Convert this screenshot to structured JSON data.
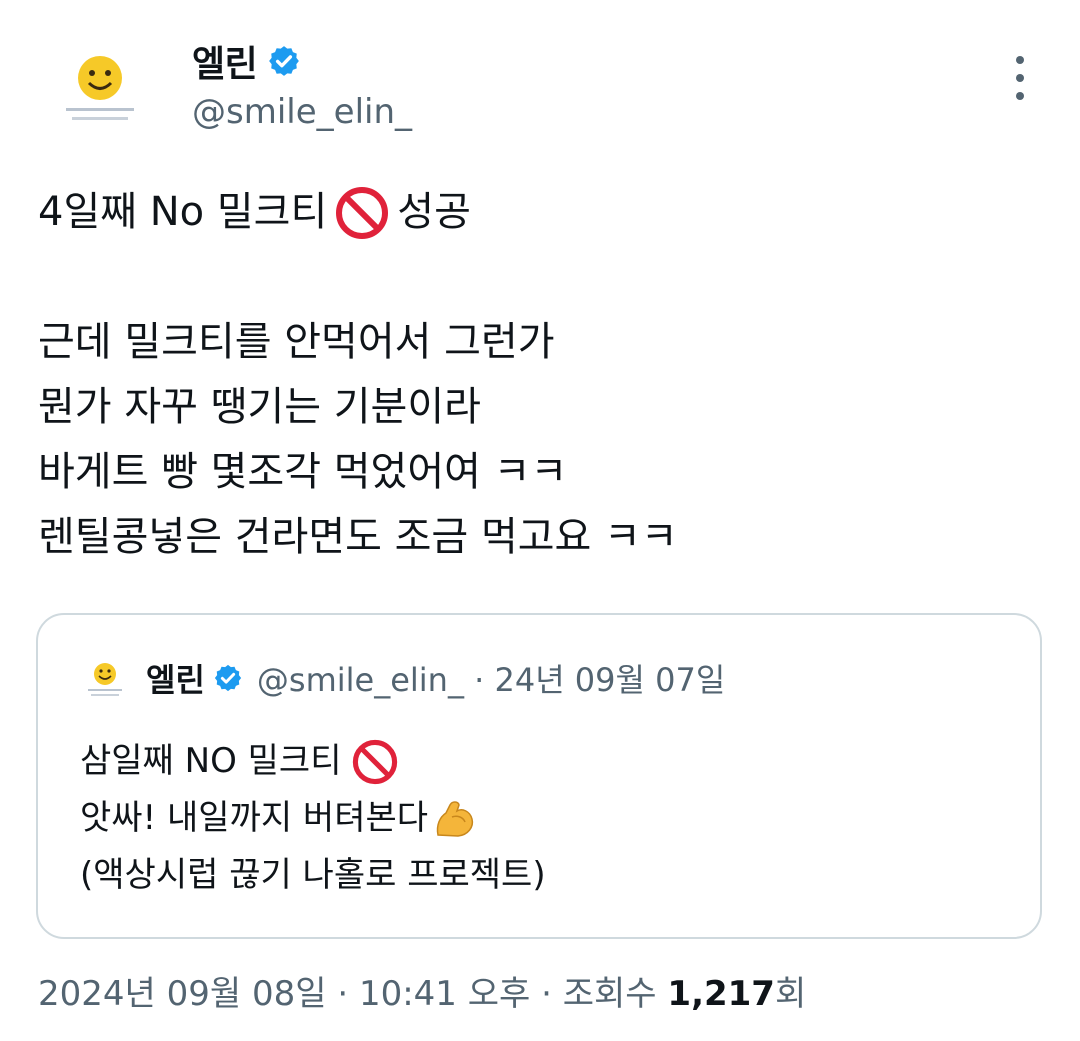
{
  "author": {
    "name": "엘린",
    "handle": "@smile_elin_",
    "verified": true,
    "avatar_icon": "smiley-face-avatar"
  },
  "tweet": {
    "lines": [
      "4일째 No 밀크티",
      "성공",
      "근데 밀크티를 안먹어서 그런가",
      "뭔가 자꾸 땡기는 기분이라",
      "바게트 빵 몇조각 먹었어여 ㅋㅋ",
      "렌틸콩넣은 건라면도 조금 먹고요 ㅋㅋ"
    ],
    "emoji": "no-entry-icon"
  },
  "quoted": {
    "name": "엘린",
    "handle": "@smile_elin_",
    "separator": "·",
    "date": "24년 09월 07일",
    "lines": [
      "삼일째 NO 밀크티",
      "앗싸! 내일까지 버텨본다",
      "(액상시럽 끊기 나홀로 프로젝트)"
    ],
    "emojis": [
      "no-entry-icon",
      "flexed-biceps-icon"
    ]
  },
  "footer": {
    "date": "2024년 09월 08일",
    "sep1": "·",
    "time": "10:41 오후",
    "sep2": "·",
    "views_label": "조회수",
    "views_count": "1,217",
    "views_suffix": "회"
  },
  "colors": {
    "text": "#0f1419",
    "secondary": "#536471",
    "verified": "#1d9bf0",
    "border": "#cfd9de",
    "no_entry_red": "#e0223a"
  }
}
